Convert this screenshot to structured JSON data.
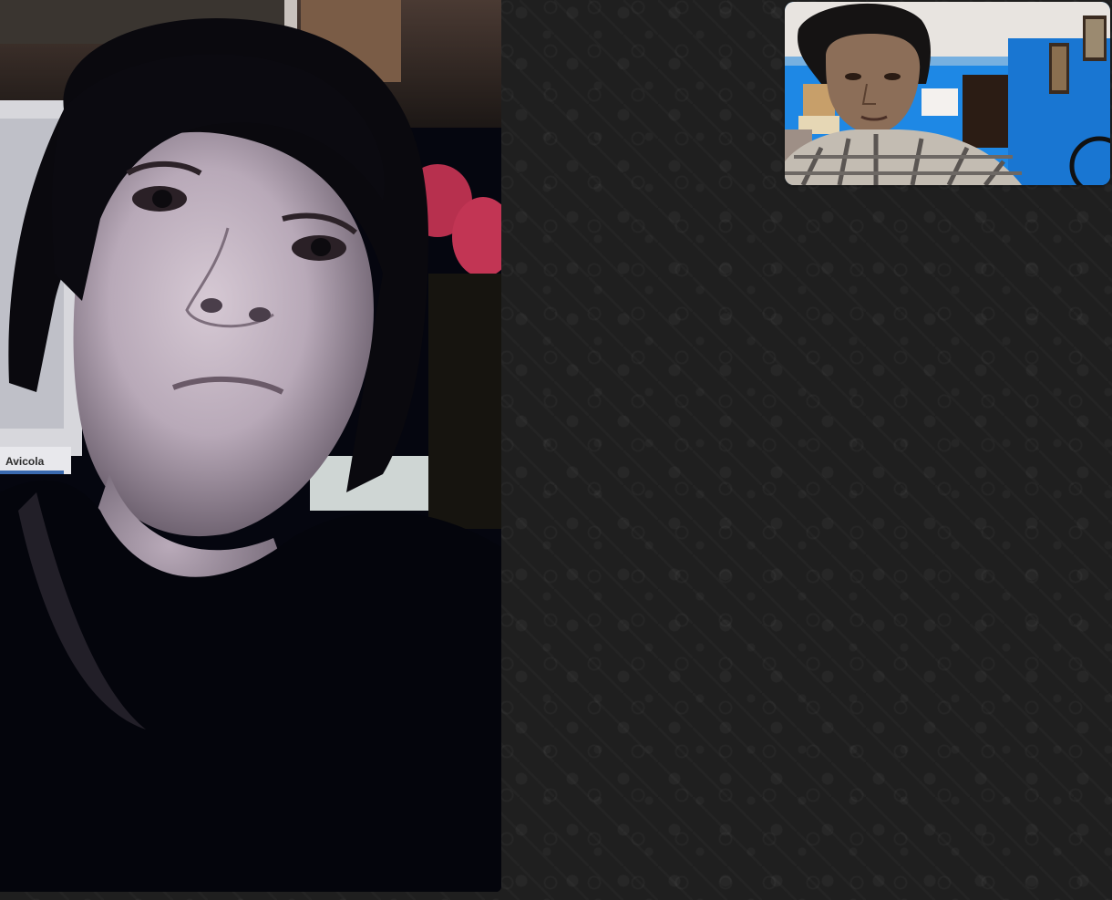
{
  "call": {
    "remote_sign_text": "Avicola"
  },
  "colors": {
    "background": "#1f1f1f",
    "self_preview_wall": "#1e88e5"
  },
  "icons": {
    "background_pattern": "doodle-pattern"
  }
}
